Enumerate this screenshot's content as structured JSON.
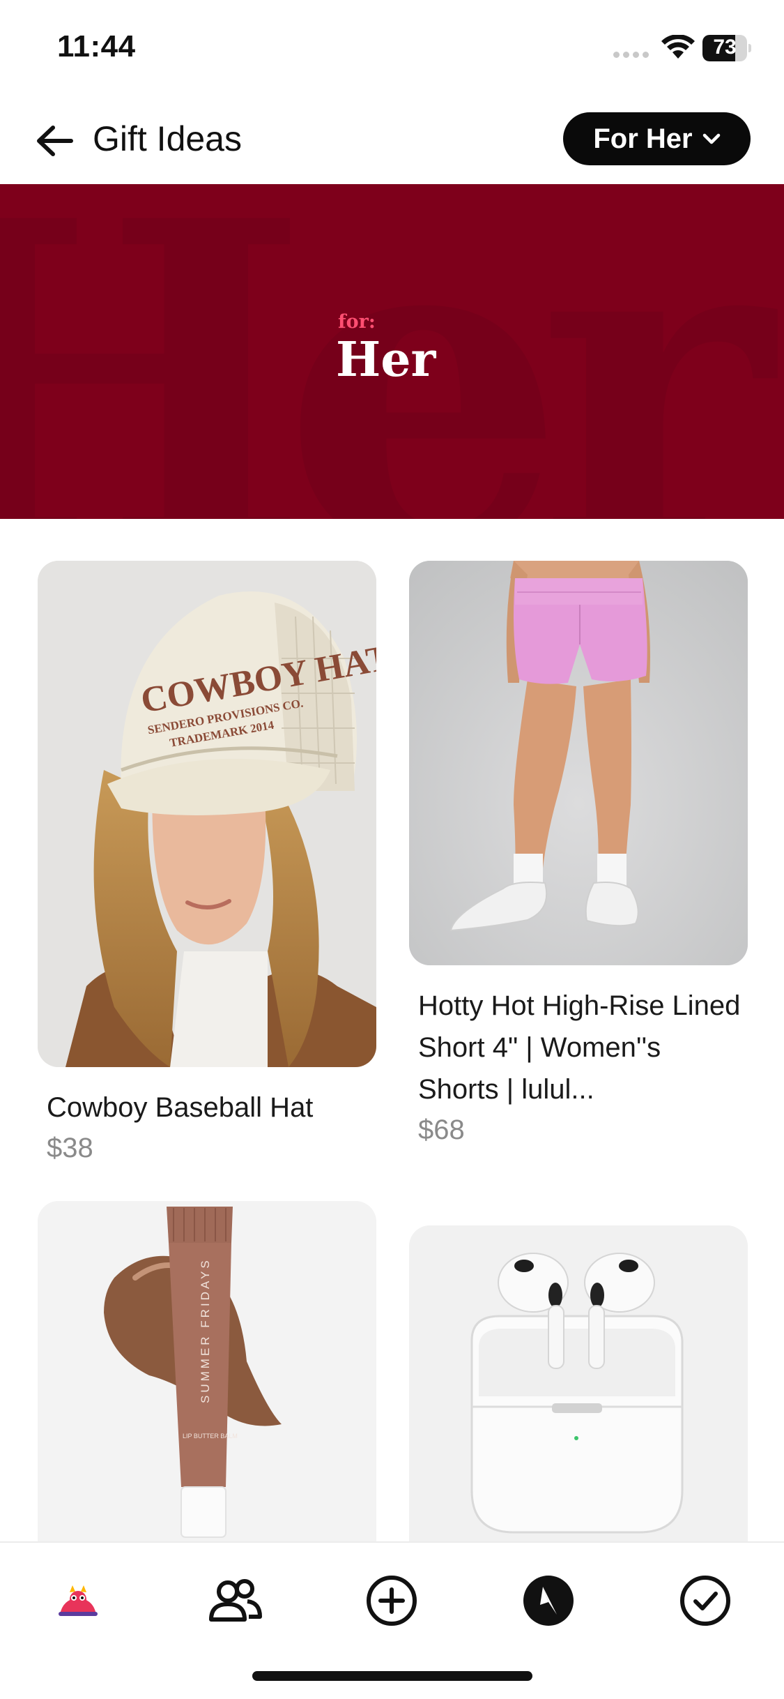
{
  "status_bar": {
    "time": "11:44",
    "battery_percent": 73,
    "battery_label": "73"
  },
  "header": {
    "title": "Gift Ideas",
    "back_icon": "arrow-left-icon",
    "filter_label": "For Her",
    "filter_icon": "chevron-down-icon"
  },
  "banner": {
    "kicker": "for:",
    "title": "Her",
    "background_word": "Her",
    "background_color": "#7e001b",
    "accent_color": "#ff4f72"
  },
  "products": [
    {
      "name": "Cowboy Baseball Hat",
      "price": "$38",
      "image": "cowboy-hat-photo",
      "hat_text_line1": "COWBOY HAT",
      "hat_text_line2": "SENDERO PROVISIONS CO.",
      "hat_text_line3": "TRADEMARK 2014"
    },
    {
      "name": "Hotty Hot High-Rise Lined Short 4\" | Women''s Shorts | lulul...",
      "price": "$68",
      "image": "pink-shorts-photo"
    },
    {
      "name": "",
      "price": "",
      "image": "lip-butter-tube-photo",
      "tube_text": "SUMMER FRIDAYS",
      "tube_subtext": "LIP BUTTER BALM"
    },
    {
      "name": "",
      "price": "",
      "image": "airpods-case-photo"
    }
  ],
  "tabbar": {
    "items": [
      {
        "name": "home",
        "icon": "mascot-icon"
      },
      {
        "name": "friends",
        "icon": "people-icon"
      },
      {
        "name": "add",
        "icon": "plus-circle-icon"
      },
      {
        "name": "explore",
        "icon": "compass-icon"
      },
      {
        "name": "done",
        "icon": "check-circle-icon"
      }
    ]
  }
}
